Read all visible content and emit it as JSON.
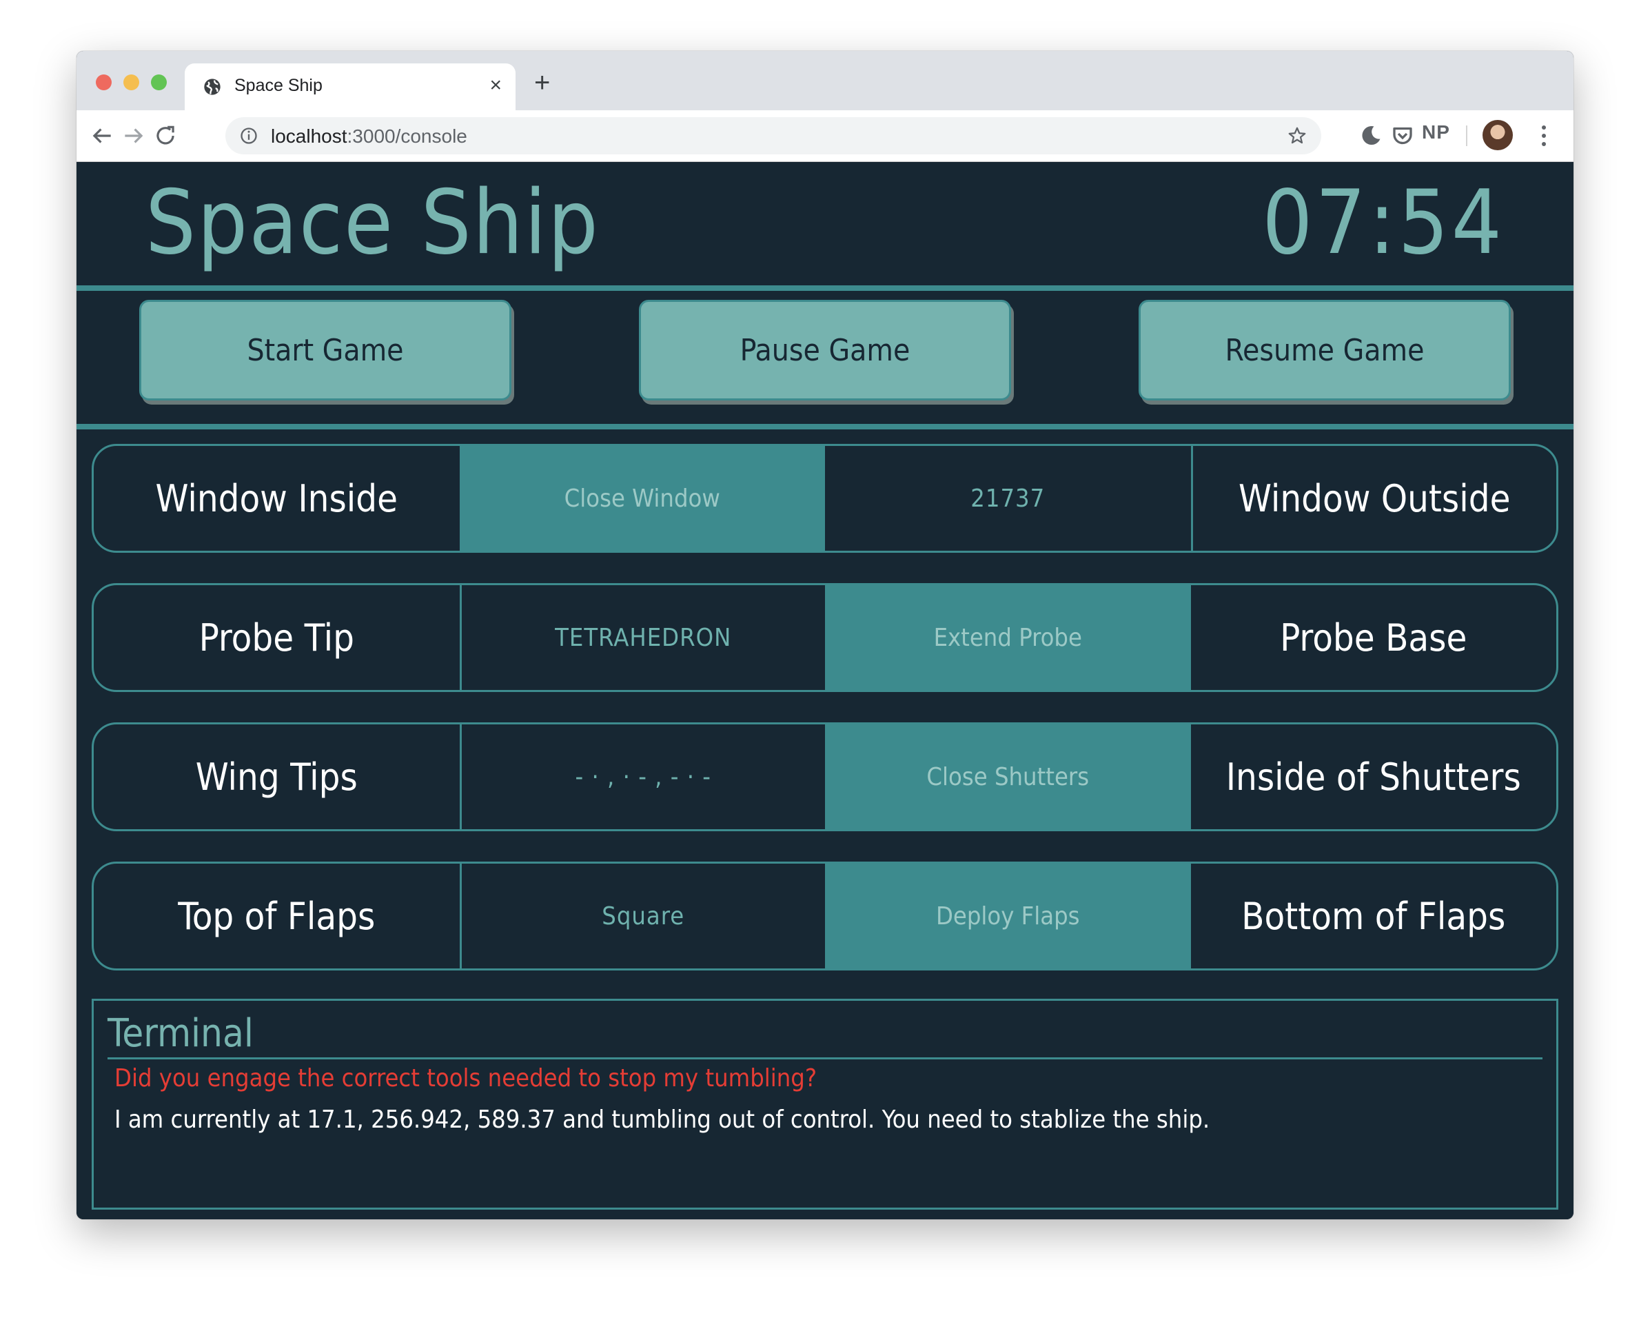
{
  "browser": {
    "tab_title": "Space Ship",
    "tab_close": "×",
    "new_tab": "+",
    "url_host": "localhost",
    "url_rest": ":3000/console",
    "profile_badge": "NP"
  },
  "header": {
    "title": "Space Ship",
    "clock": "07:54"
  },
  "controls": {
    "start": "Start Game",
    "pause": "Pause Game",
    "resume": "Resume Game"
  },
  "rows": [
    {
      "left": "Window Inside",
      "action": "Close Window",
      "value": "21737",
      "right": "Window Outside"
    },
    {
      "left": "Probe Tip",
      "value": "TETRAHEDRON",
      "action": "Extend Probe",
      "right": "Probe Base"
    },
    {
      "left": "Wing Tips",
      "value": "- · , · - , - · -",
      "action": "Close Shutters",
      "right": "Inside of Shutters"
    },
    {
      "left": "Top of Flaps",
      "value": "Square",
      "action": "Deploy Flaps",
      "right": "Bottom of Flaps"
    }
  ],
  "terminal": {
    "title": "Terminal",
    "error": "Did you engage the correct tools needed to stop my tumbling?",
    "message": "I am currently at 17.1, 256.942, 589.37 and tumbling out of control. You need to stablize the ship."
  },
  "colors": {
    "background": "#172733",
    "accent": "#3d8b8e",
    "button": "#76b3af",
    "error": "#e53d35"
  },
  "icons": [
    "globe-icon",
    "back-arrow-icon",
    "forward-arrow-icon",
    "reload-icon",
    "info-icon",
    "star-icon",
    "moon-icon",
    "pocket-icon",
    "kebab-menu-icon"
  ]
}
